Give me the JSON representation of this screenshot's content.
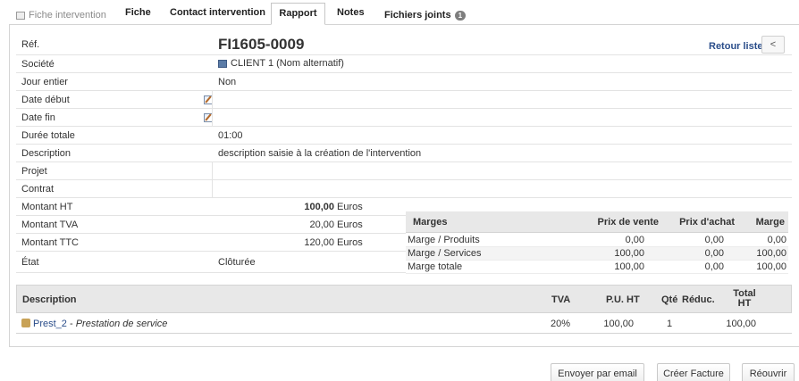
{
  "tabs": {
    "fiche_intervention": "Fiche intervention",
    "fiche": "Fiche",
    "contact": "Contact intervention",
    "rapport": "Rapport",
    "notes": "Notes",
    "fichiers": "Fichiers joints",
    "fichiers_count": "1"
  },
  "header": {
    "ref_label": "Réf.",
    "ref_value": "FI1605-0009",
    "retour_liste": "Retour liste",
    "prev": "<"
  },
  "fields": {
    "societe_label": "Société",
    "societe_value": "CLIENT 1 (Nom alternatif)",
    "jour_entier_label": "Jour entier",
    "jour_entier_value": "Non",
    "date_debut_label": "Date début",
    "date_fin_label": "Date fin",
    "duree_label": "Durée totale",
    "duree_value": "01:00",
    "description_label": "Description",
    "description_value": "description saisie à la création de l'intervention",
    "projet_label": "Projet",
    "contrat_label": "Contrat",
    "montant_ht_label": "Montant HT",
    "montant_ht_value": "100,00",
    "montant_tva_label": "Montant TVA",
    "montant_tva_value": "20,00",
    "montant_ttc_label": "Montant TTC",
    "montant_ttc_value": "120,00",
    "currency": "Euros",
    "etat_label": "État",
    "etat_value": "Clôturée"
  },
  "marges": {
    "headers": [
      "Marges",
      "Prix de vente",
      "Prix d'achat",
      "Marge"
    ],
    "rows": [
      [
        "Marge / Produits",
        "0,00",
        "0,00",
        "0,00"
      ],
      [
        "Marge / Services",
        "100,00",
        "0,00",
        "100,00"
      ],
      [
        "Marge totale",
        "100,00",
        "0,00",
        "100,00"
      ]
    ]
  },
  "lines": {
    "headers": {
      "description": "Description",
      "tva": "TVA",
      "pu_ht": "P.U. HT",
      "qte": "Qté",
      "reduc": "Réduc.",
      "total_ht_1": "Total",
      "total_ht_2": "HT"
    },
    "items": [
      {
        "ref": "Prest_2",
        "separator": " - ",
        "label": "Prestation de service",
        "tva": "20%",
        "pu_ht": "100,00",
        "qte": "1",
        "reduc": "",
        "total_ht": "100,00"
      }
    ]
  },
  "actions": {
    "email": "Envoyer par email",
    "facture": "Créer Facture",
    "reouvrir": "Réouvrir"
  },
  "colors": {
    "link": "#2a4d8a",
    "header_bg": "#e8e8e8",
    "border": "#d4d4d4"
  }
}
